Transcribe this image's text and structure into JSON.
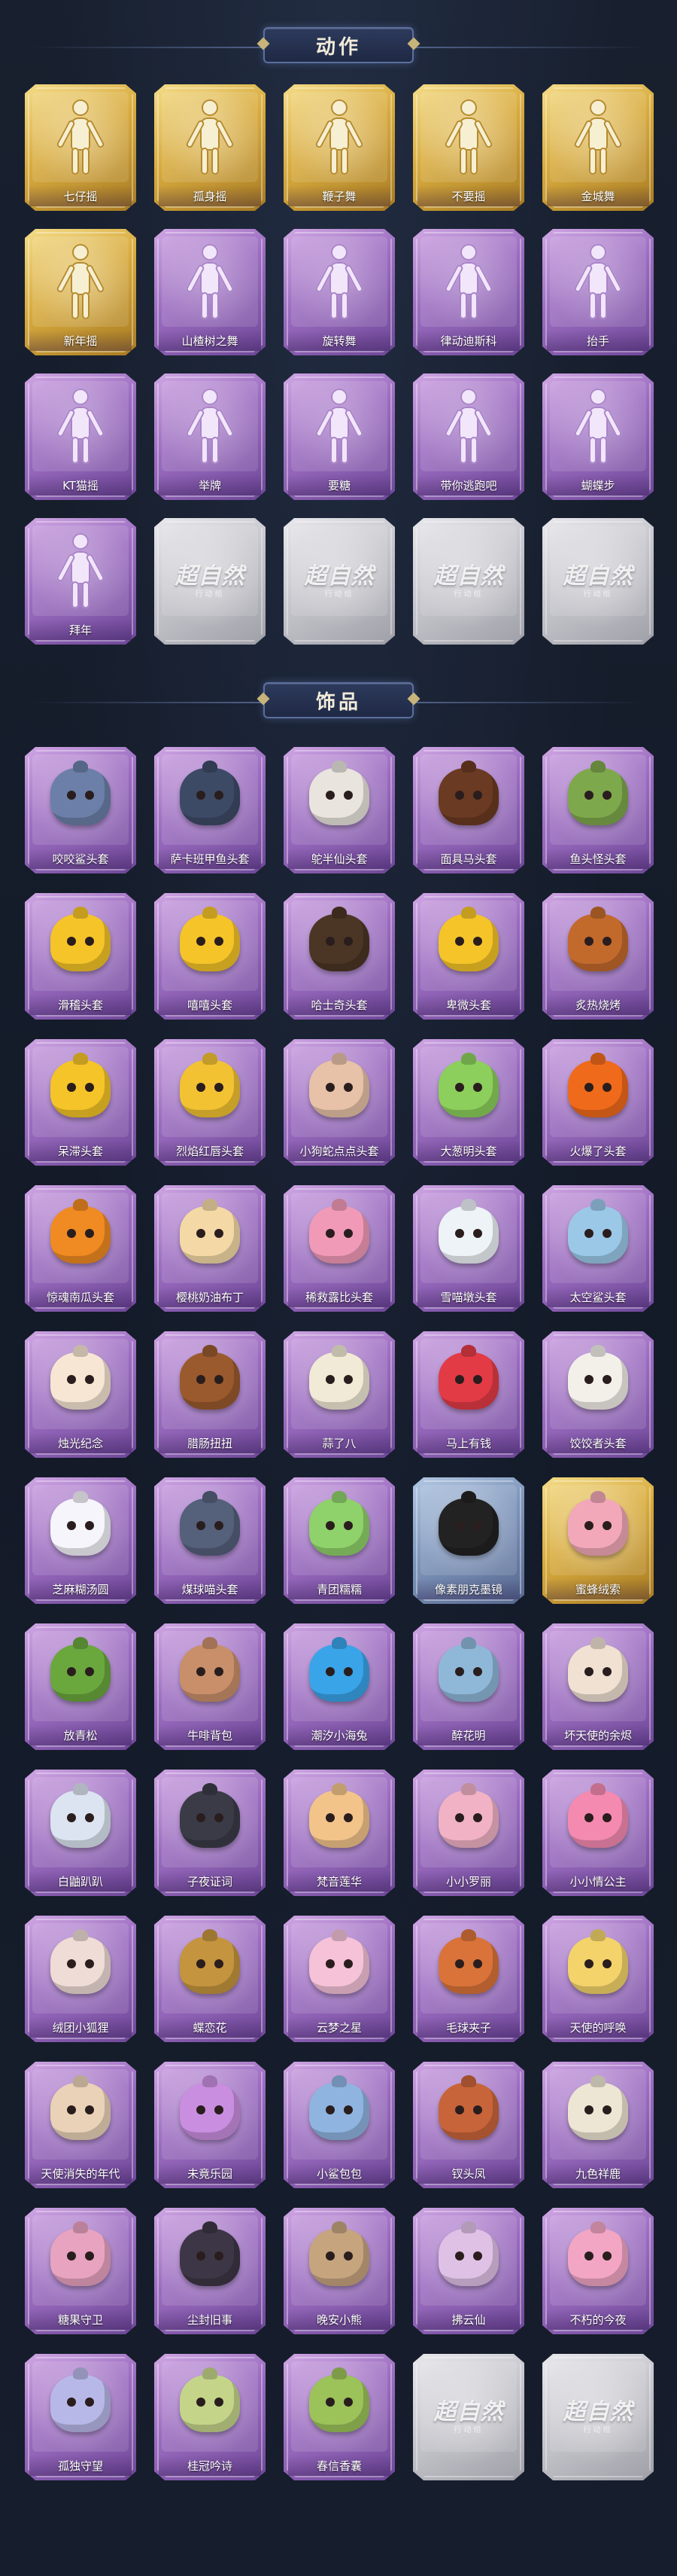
{
  "sections": {
    "actions": {
      "title": "动作",
      "items": [
        {
          "label": "七仔摇",
          "rarity": "gold",
          "color": "#f3e3a8"
        },
        {
          "label": "孤身摇",
          "rarity": "gold",
          "color": "#f3e3a8"
        },
        {
          "label": "鞭子舞",
          "rarity": "gold",
          "color": "#f3e3a8"
        },
        {
          "label": "不要摇",
          "rarity": "gold",
          "color": "#f3e3a8"
        },
        {
          "label": "金城舞",
          "rarity": "gold",
          "color": "#f3e3a8"
        },
        {
          "label": "新年摇",
          "rarity": "gold",
          "color": "#f3e3a8"
        },
        {
          "label": "山楂树之舞",
          "rarity": "purple",
          "color": "#eedcf7"
        },
        {
          "label": "旋转舞",
          "rarity": "purple",
          "color": "#eedcf7"
        },
        {
          "label": "律动迪斯科",
          "rarity": "purple",
          "color": "#eedcf7"
        },
        {
          "label": "抬手",
          "rarity": "purple",
          "color": "#eedcf7"
        },
        {
          "label": "KT猫摇",
          "rarity": "purple",
          "color": "#eedcf7"
        },
        {
          "label": "举牌",
          "rarity": "purple",
          "color": "#eedcf7"
        },
        {
          "label": "要糖",
          "rarity": "purple",
          "color": "#eedcf7"
        },
        {
          "label": "带你逃跑吧",
          "rarity": "purple",
          "color": "#eedcf7"
        },
        {
          "label": "蝴蝶步",
          "rarity": "purple",
          "color": "#eedcf7"
        },
        {
          "label": "拜年",
          "rarity": "purple",
          "color": "#eedcf7"
        },
        {
          "label": "",
          "rarity": "empty",
          "logo": "超自然",
          "logo_sub": "行动组"
        },
        {
          "label": "",
          "rarity": "empty",
          "logo": "超自然",
          "logo_sub": "行动组"
        },
        {
          "label": "",
          "rarity": "empty",
          "logo": "超自然",
          "logo_sub": "行动组"
        },
        {
          "label": "",
          "rarity": "empty",
          "logo": "超自然",
          "logo_sub": "行动组"
        }
      ]
    },
    "accessories": {
      "title": "饰品",
      "items": [
        {
          "label": "咬咬鲨头套",
          "rarity": "purple",
          "color": "#6b7fa8"
        },
        {
          "label": "萨卡班甲鱼头套",
          "rarity": "purple",
          "color": "#3d4a66"
        },
        {
          "label": "鸵半仙头套",
          "rarity": "purple",
          "color": "#e9e4dd"
        },
        {
          "label": "面具马头套",
          "rarity": "purple",
          "color": "#6b3a22"
        },
        {
          "label": "鱼头怪头套",
          "rarity": "purple",
          "color": "#7ea84c"
        },
        {
          "label": "滑稽头套",
          "rarity": "purple",
          "color": "#f5c428"
        },
        {
          "label": "嘻嘻头套",
          "rarity": "purple",
          "color": "#f5c428"
        },
        {
          "label": "哈士奇头套",
          "rarity": "purple",
          "color": "#4b3524"
        },
        {
          "label": "卑微头套",
          "rarity": "purple",
          "color": "#f5c428"
        },
        {
          "label": "炙热烧烤",
          "rarity": "purple",
          "color": "#c26a2c"
        },
        {
          "label": "呆滞头套",
          "rarity": "purple",
          "color": "#f5c428"
        },
        {
          "label": "烈焰红唇头套",
          "rarity": "purple",
          "color": "#f2c233"
        },
        {
          "label": "小狗蛇点点头套",
          "rarity": "purple",
          "color": "#e7c1a8"
        },
        {
          "label": "大葱明头套",
          "rarity": "purple",
          "color": "#8ccf5c"
        },
        {
          "label": "火爆了头套",
          "rarity": "purple",
          "color": "#f06a1c"
        },
        {
          "label": "惊魂南瓜头套",
          "rarity": "purple",
          "color": "#f08a22"
        },
        {
          "label": "樱桃奶油布丁",
          "rarity": "purple",
          "color": "#f4d9a6"
        },
        {
          "label": "稀救露比头套",
          "rarity": "purple",
          "color": "#f19ab8"
        },
        {
          "label": "雪喵墩头套",
          "rarity": "purple",
          "color": "#eef3f7"
        },
        {
          "label": "太空鲨头套",
          "rarity": "purple",
          "color": "#9cc8e8"
        },
        {
          "label": "烛光纪念",
          "rarity": "purple",
          "color": "#f7e6d3"
        },
        {
          "label": "腊肠扭扭",
          "rarity": "purple",
          "color": "#9a5a2e"
        },
        {
          "label": "蒜了八",
          "rarity": "purple",
          "color": "#f1ead6"
        },
        {
          "label": "马上有钱",
          "rarity": "purple",
          "color": "#e23b45"
        },
        {
          "label": "饺饺者头套",
          "rarity": "purple",
          "color": "#f3f0ea"
        },
        {
          "label": "芝麻糊汤圆",
          "rarity": "purple",
          "color": "#f5f5fb"
        },
        {
          "label": "煤球喵头套",
          "rarity": "purple",
          "color": "#55607a"
        },
        {
          "label": "青团糯糯",
          "rarity": "purple",
          "color": "#8fd16a"
        },
        {
          "label": "像素朋克墨镜",
          "rarity": "blue",
          "color": "#222222"
        },
        {
          "label": "蜜蜂绒索",
          "rarity": "gold",
          "color": "#f2a8b8"
        },
        {
          "label": "放青松",
          "rarity": "purple",
          "color": "#6aa83e"
        },
        {
          "label": "牛啡背包",
          "rarity": "purple",
          "color": "#c98f6a"
        },
        {
          "label": "潮汐小海兔",
          "rarity": "purple",
          "color": "#3aa4e8"
        },
        {
          "label": "醉花明",
          "rarity": "purple",
          "color": "#8fb8d8"
        },
        {
          "label": "坏天使的余烬",
          "rarity": "purple",
          "color": "#f0e1d2"
        },
        {
          "label": "白鼬趴趴",
          "rarity": "purple",
          "color": "#dbe4f0"
        },
        {
          "label": "子夜证词",
          "rarity": "purple",
          "color": "#3b3b48"
        },
        {
          "label": "梵音莲华",
          "rarity": "purple",
          "color": "#f3c48a"
        },
        {
          "label": "小小罗丽",
          "rarity": "purple",
          "color": "#f1b2c6"
        },
        {
          "label": "小小情公主",
          "rarity": "purple",
          "color": "#f48ab0"
        },
        {
          "label": "绒团小狐狸",
          "rarity": "purple",
          "color": "#f0dcd6"
        },
        {
          "label": "蝶恋花",
          "rarity": "purple",
          "color": "#c4943e"
        },
        {
          "label": "云梦之星",
          "rarity": "purple",
          "color": "#f5c2d8"
        },
        {
          "label": "毛球夹子",
          "rarity": "purple",
          "color": "#d9733a"
        },
        {
          "label": "天使的呼唤",
          "rarity": "purple",
          "color": "#f3d36a"
        },
        {
          "label": "天使消失的年代",
          "rarity": "purple",
          "color": "#e9d2b8"
        },
        {
          "label": "未竟乐园",
          "rarity": "purple",
          "color": "#c98ee0"
        },
        {
          "label": "小鲨包包",
          "rarity": "purple",
          "color": "#8fb4e0"
        },
        {
          "label": "钗头凤",
          "rarity": "purple",
          "color": "#c8643a"
        },
        {
          "label": "九色祥鹿",
          "rarity": "purple",
          "color": "#eee6d4"
        },
        {
          "label": "糖果守卫",
          "rarity": "purple",
          "color": "#e8a3c0"
        },
        {
          "label": "尘封旧事",
          "rarity": "purple",
          "color": "#3d3646"
        },
        {
          "label": "晚安小熊",
          "rarity": "purple",
          "color": "#c6a47e"
        },
        {
          "label": "拂云仙",
          "rarity": "purple",
          "color": "#e0c1e6"
        },
        {
          "label": "不朽的今夜",
          "rarity": "purple",
          "color": "#f2a6c4"
        },
        {
          "label": "孤独守望",
          "rarity": "purple",
          "color": "#b8b8e8"
        },
        {
          "label": "桂冠吟诗",
          "rarity": "purple",
          "color": "#c4d58a"
        },
        {
          "label": "春信香囊",
          "rarity": "purple",
          "color": "#9cc25a"
        },
        {
          "label": "",
          "rarity": "empty",
          "logo": "超自然",
          "logo_sub": "行动组"
        },
        {
          "label": "",
          "rarity": "empty",
          "logo": "超自然",
          "logo_sub": "行动组"
        }
      ]
    }
  }
}
